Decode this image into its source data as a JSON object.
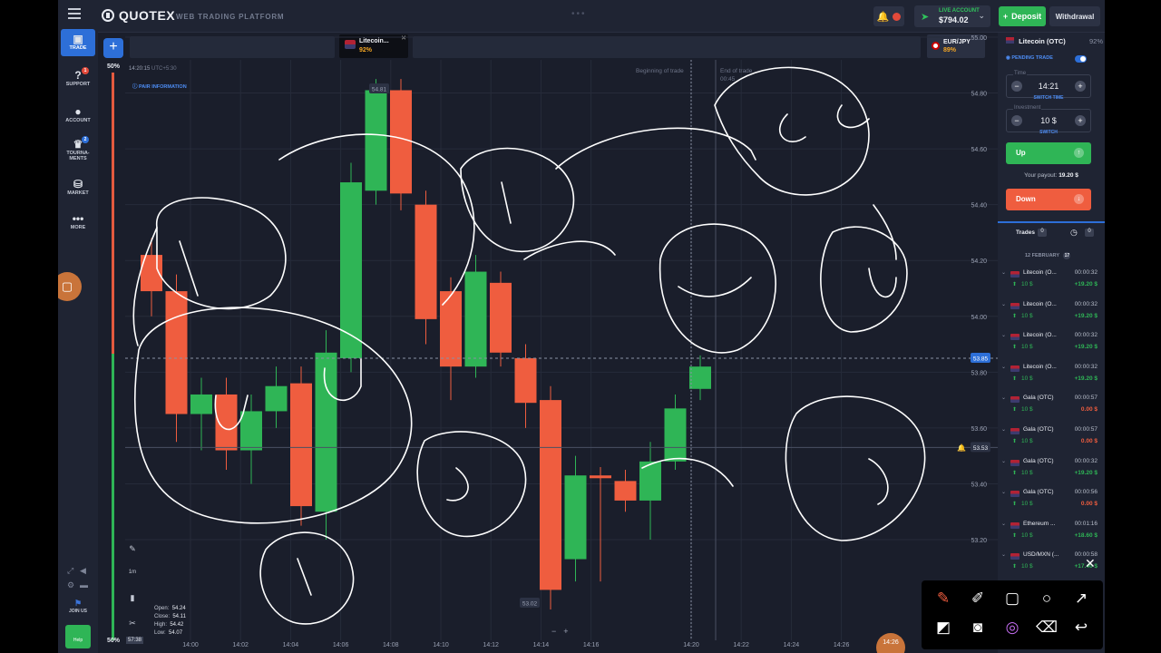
{
  "header": {
    "logo": "QUOTEX",
    "subtitle": "WEB TRADING PLATFORM",
    "account_type": "LIVE ACCOUNT",
    "balance": "$794.02",
    "deposit_label": "Deposit",
    "withdraw_label": "Withdrawal"
  },
  "sidebar": {
    "items": [
      {
        "label": "TRADE",
        "icon": "chart-icon"
      },
      {
        "label": "SUPPORT",
        "icon": "question-icon"
      },
      {
        "label": "ACCOUNT",
        "icon": "user-icon"
      },
      {
        "label": "TOURNA-MENTS",
        "icon": "trophy-icon"
      },
      {
        "label": "MARKET",
        "icon": "market-icon"
      },
      {
        "label": "MORE",
        "icon": "dots-icon"
      }
    ],
    "join_label": "JOIN US",
    "help_label": "Help"
  },
  "chart": {
    "active_pair_name": "Litecoin...",
    "active_pair_pct": "92%",
    "second_pair_name": "EUR/JPY",
    "second_pair_pct": "89%",
    "top_pct": "50%",
    "bottom_pct": "50%",
    "clock": "14:20:15",
    "timezone": "UTC+5:30",
    "pair_info": "PAIR INFORMATION",
    "beginning_label": "Beginning of trade",
    "end_label": "End of trade",
    "end_time": "00:45",
    "current_price": "53.85",
    "alert_price": "53.53",
    "high_marker": "54.81",
    "low_marker": "53.02",
    "current_time_label": "57:38",
    "timeframe": "1m",
    "ohlc": {
      "open": "54.24",
      "close": "54.11",
      "high": "54.42",
      "low": "54.07"
    }
  },
  "chart_data": {
    "type": "candlestick",
    "y_ticks": [
      "55.00",
      "54.80",
      "54.60",
      "54.40",
      "54.20",
      "54.00",
      "53.80",
      "53.60",
      "53.40",
      "53.20"
    ],
    "x_ticks": [
      "14:00",
      "14:02",
      "14:04",
      "14:06",
      "14:08",
      "14:10",
      "14:12",
      "14:14",
      "14:16",
      "14:20",
      "14:22",
      "14:24",
      "14:26"
    ],
    "ylim": [
      53.05,
      55.0
    ],
    "candles": [
      {
        "open": 54.22,
        "close": 54.09,
        "high": 54.28,
        "low": 54.0
      },
      {
        "open": 54.09,
        "close": 53.65,
        "high": 54.15,
        "low": 53.55
      },
      {
        "open": 53.65,
        "close": 53.72,
        "high": 53.78,
        "low": 53.52
      },
      {
        "open": 53.72,
        "close": 53.52,
        "high": 53.78,
        "low": 53.45
      },
      {
        "open": 53.52,
        "close": 53.66,
        "high": 53.72,
        "low": 53.4
      },
      {
        "open": 53.66,
        "close": 53.75,
        "high": 53.82,
        "low": 53.6
      },
      {
        "open": 53.76,
        "close": 53.32,
        "high": 53.82,
        "low": 53.25
      },
      {
        "open": 53.3,
        "close": 53.87,
        "high": 53.95,
        "low": 53.2
      },
      {
        "open": 53.85,
        "close": 54.48,
        "high": 54.55,
        "low": 53.8
      },
      {
        "open": 54.45,
        "close": 54.81,
        "high": 54.85,
        "low": 54.4
      },
      {
        "open": 54.81,
        "close": 54.44,
        "high": 54.85,
        "low": 54.38
      },
      {
        "open": 54.4,
        "close": 53.99,
        "high": 54.45,
        "low": 53.9
      },
      {
        "open": 54.09,
        "close": 53.82,
        "high": 54.14,
        "low": 53.7
      },
      {
        "open": 53.82,
        "close": 54.16,
        "high": 54.22,
        "low": 53.78
      },
      {
        "open": 54.12,
        "close": 53.87,
        "high": 54.16,
        "low": 53.82
      },
      {
        "open": 53.85,
        "close": 53.69,
        "high": 53.9,
        "low": 53.6
      },
      {
        "open": 53.7,
        "close": 53.02,
        "high": 53.75,
        "low": 52.95
      },
      {
        "open": 53.13,
        "close": 53.43,
        "high": 53.5,
        "low": 53.05
      },
      {
        "open": 53.43,
        "close": 53.42,
        "high": 53.46,
        "low": 53.05
      },
      {
        "open": 53.41,
        "close": 53.34,
        "high": 53.45,
        "low": 53.3
      },
      {
        "open": 53.34,
        "close": 53.48,
        "high": 53.55,
        "low": 53.2
      },
      {
        "open": 53.48,
        "close": 53.67,
        "high": 53.72,
        "low": 53.45
      },
      {
        "open": 53.74,
        "close": 53.82,
        "high": 53.86,
        "low": 53.7
      }
    ]
  },
  "panel": {
    "asset": "Litecoin (OTC)",
    "asset_pct": "92%",
    "pending_label": "PENDING TRADE",
    "time_label": "Time",
    "time_value": "14:21",
    "switch_time": "SWITCH TIME",
    "investment_label": "Investment",
    "investment_value": "10 $",
    "switch_label": "SWITCH",
    "up_label": "Up",
    "down_label": "Down",
    "payout_label": "Your payout:",
    "payout_value": "19.20 $",
    "trades_label": "Trades",
    "trades_count": "0",
    "history_count": "0",
    "date_header": "12 FEBRUARY",
    "date_count": "17"
  },
  "trades": [
    {
      "name": "Litecoin (O...",
      "time": "00:00:32",
      "amount": "10 $",
      "payout": "+19.20 $",
      "win": true
    },
    {
      "name": "Litecoin (O...",
      "time": "00:00:32",
      "amount": "10 $",
      "payout": "+19.20 $",
      "win": true
    },
    {
      "name": "Litecoin (O...",
      "time": "00:00:32",
      "amount": "10 $",
      "payout": "+19.20 $",
      "win": true
    },
    {
      "name": "Litecoin (O...",
      "time": "00:00:32",
      "amount": "10 $",
      "payout": "+19.20 $",
      "win": true
    },
    {
      "name": "Gala (OTC)",
      "time": "00:00:57",
      "amount": "10 $",
      "payout": "0.00 $",
      "win": false
    },
    {
      "name": "Gala (OTC)",
      "time": "00:00:57",
      "amount": "10 $",
      "payout": "0.00 $",
      "win": false
    },
    {
      "name": "Gala (OTC)",
      "time": "00:00:32",
      "amount": "10 $",
      "payout": "+19.20 $",
      "win": true
    },
    {
      "name": "Gala (OTC)",
      "time": "00:00:56",
      "amount": "10 $",
      "payout": "0.00 $",
      "win": false
    },
    {
      "name": "Ethereum ...",
      "time": "00:01:16",
      "amount": "10 $",
      "payout": "+18.60 $",
      "win": true
    },
    {
      "name": "USD/MXN (...",
      "time": "00:00:58",
      "amount": "10 $",
      "payout": "+17.40 $",
      "win": true
    }
  ],
  "colors": {
    "bg": "#1a1e2b",
    "green": "#2fb556",
    "red": "#ef5d3f",
    "accent": "#2d6fd8"
  },
  "draw_toolbar": [
    "brush-icon",
    "marker-icon",
    "rectangle-icon",
    "circle-icon",
    "arrow-icon",
    "checker-icon",
    "camera-icon",
    "color-wheel-icon",
    "eraser-icon",
    "undo-icon"
  ]
}
